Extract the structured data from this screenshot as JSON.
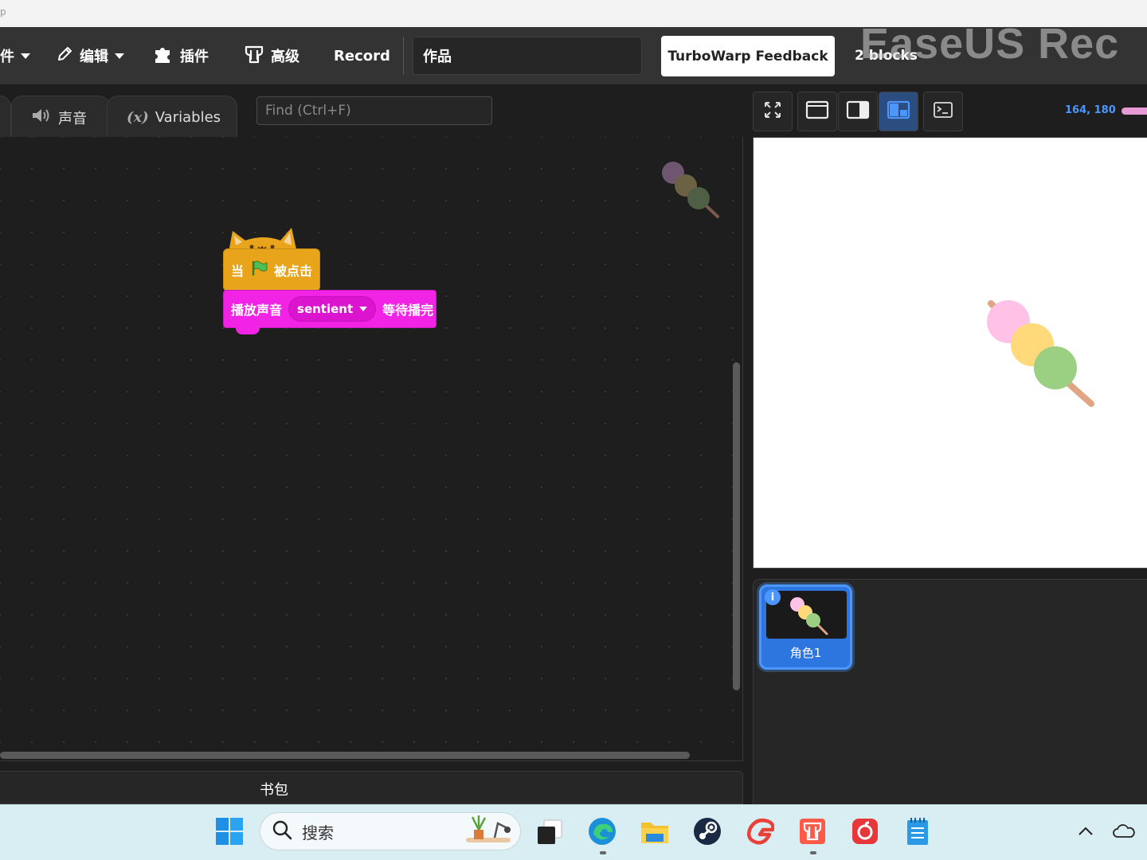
{
  "top_strip": {
    "glyph": "p"
  },
  "menubar": {
    "file_label": "件",
    "edit_label": "编辑",
    "addons_label": "插件",
    "advanced_label": "高级",
    "record_label": "Record",
    "project_title": "作品",
    "feedback_label": "TurboWarp Feedback",
    "blocks_count": "2 blocks",
    "watermark": "EaseUS Rec"
  },
  "tabs": {
    "sounds_label": "声音",
    "variables_icon": "(x)",
    "variables_label": "Variables"
  },
  "find": {
    "placeholder": "Find (Ctrl+F)"
  },
  "blocks": {
    "hat_when": "当",
    "hat_clicked": "被点击",
    "sound_play": "播放声音",
    "sound_name": "sentient",
    "sound_wait": "等待播完"
  },
  "backpack": {
    "label": "书包"
  },
  "stage": {
    "coords": "164, 180"
  },
  "sprites": [
    {
      "name": "角色1",
      "info": "i"
    }
  ],
  "taskbar": {
    "search_placeholder": "搜索"
  },
  "colors": {
    "accent": "#4c97ff",
    "event_block": "#e8a51c",
    "sound_block": "#f124e6",
    "menubar": "#333333"
  },
  "icons": [
    "pencil-icon",
    "puzzle-icon",
    "turbowarp-icon",
    "speaker-icon",
    "fullscreen-icon",
    "small-stage-icon",
    "normal-stage-icon",
    "large-stage-icon",
    "terminal-icon",
    "windows-start-icon",
    "search-icon",
    "task-view-icon",
    "edge-icon",
    "folder-icon",
    "steam-icon",
    "app-icon",
    "turbowarp-taskbar-icon",
    "netease-music-icon",
    "notepad-icon",
    "chevron-up-icon",
    "onedrive-icon"
  ]
}
